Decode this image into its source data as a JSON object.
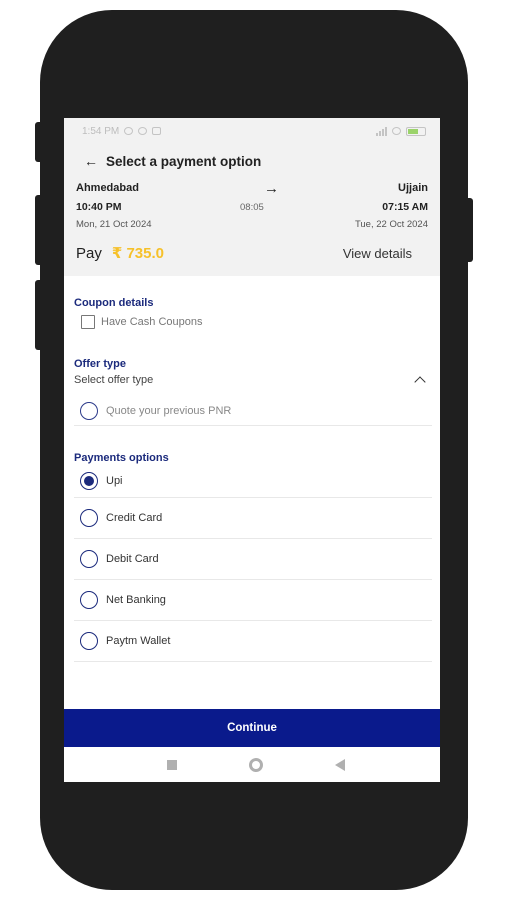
{
  "statusbar": {
    "time": "1:54 PM",
    "icons": [
      "wifi-icon",
      "battery-icon"
    ]
  },
  "header": {
    "title": "Select a payment option",
    "back_icon": "arrow-left-icon"
  },
  "journey": {
    "from": "Ahmedabad",
    "to": "Ujjain",
    "departure_time": "10:40 PM",
    "duration": "08:05",
    "arrival_time": "07:15 AM",
    "departure_date": "Mon, 21 Oct 2024",
    "arrival_date": "Tue, 22 Oct 2024"
  },
  "pay": {
    "label": "Pay",
    "amount": "₹ 735.0",
    "view_details": "View details"
  },
  "coupon": {
    "title": "Coupon details",
    "checkbox_label": "Have Cash Coupons"
  },
  "offer": {
    "title": "Offer type",
    "select_label": "Select offer type",
    "option_label": "Quote your previous PNR"
  },
  "payments": {
    "title": "Payments options",
    "options": [
      {
        "label": "Upi",
        "selected": true
      },
      {
        "label": "Credit Card",
        "selected": false
      },
      {
        "label": "Debit Card",
        "selected": false
      },
      {
        "label": "Net Banking",
        "selected": false
      },
      {
        "label": "Paytm Wallet",
        "selected": false
      }
    ]
  },
  "continue_label": "Continue",
  "colors": {
    "primary": "#0a1a8c",
    "section_title": "#1b2a7c",
    "amount": "#f6c12a",
    "header_bg": "#f2f2f2"
  }
}
